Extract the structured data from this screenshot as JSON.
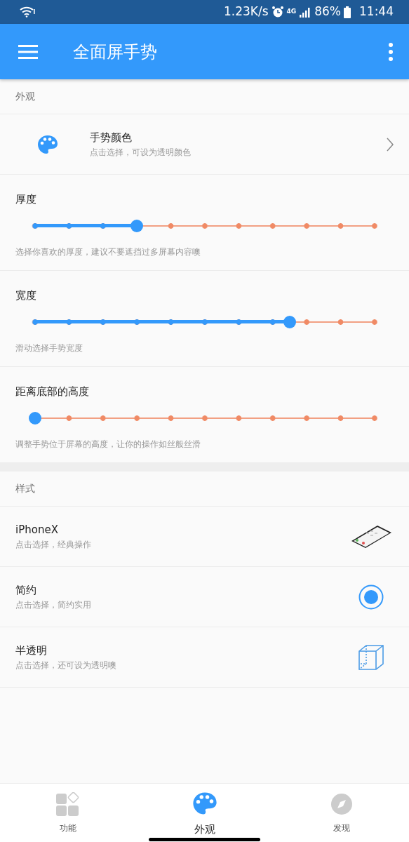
{
  "status_bar": {
    "speed": "1.23K/s",
    "network": "4G",
    "battery": "86%",
    "time": "11:44"
  },
  "app_bar": {
    "title": "全面屏手势"
  },
  "sections": [
    {
      "header": "外观",
      "items": [
        {
          "kind": "link",
          "title": "手势颜色",
          "subtitle": "点击选择，可设为透明颜色"
        },
        {
          "kind": "slider",
          "title": "厚度",
          "level": 0.3,
          "subtitle": "选择你喜欢的厚度，建议不要遮挡过多屏幕内容噢"
        },
        {
          "kind": "slider",
          "title": "宽度",
          "level": 0.75,
          "subtitle": "滑动选择手势宽度"
        },
        {
          "kind": "slider",
          "title": "距离底部的高度",
          "level": 0,
          "subtitle": "调整手势位于屏幕的高度，让你的操作如丝般丝滑"
        }
      ]
    },
    {
      "header": "样式",
      "items": [
        {
          "kind": "phone",
          "title": "iPhoneX",
          "subtitle": "点击选择，经典操作",
          "selected": false
        },
        {
          "kind": "plain",
          "title": "简约",
          "subtitle": "点击选择，简约实用",
          "selected": true
        },
        {
          "kind": "cube",
          "title": "半透明",
          "subtitle": "点击选择，还可设为透明噢",
          "selected": false
        }
      ]
    }
  ],
  "bottom_nav": [
    {
      "label": "功能",
      "kind": "grid",
      "selected": false
    },
    {
      "label": "外观",
      "kind": "palette",
      "selected": true
    },
    {
      "label": "发现",
      "kind": "compass",
      "selected": false
    }
  ]
}
